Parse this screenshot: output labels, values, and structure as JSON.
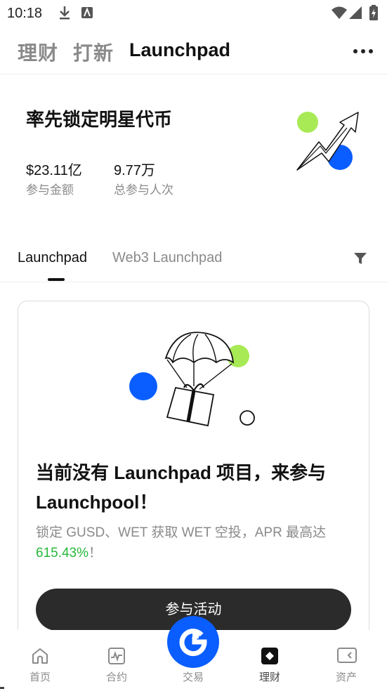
{
  "status_bar": {
    "time": "10:18",
    "icons": [
      "download-icon",
      "app-notification-icon",
      "wifi-icon",
      "signal-icon",
      "battery-icon"
    ]
  },
  "top_nav": {
    "tabs": [
      {
        "label": "理财",
        "active": false
      },
      {
        "label": "打新",
        "active": false
      },
      {
        "label": "Launchpad",
        "active": true
      }
    ],
    "more_icon": "more-dots-icon"
  },
  "hero": {
    "title": "率先锁定明星代币",
    "stats": [
      {
        "value": "$23.11亿",
        "label": "参与金额"
      },
      {
        "value": "9.77万",
        "label": "总参与人次"
      }
    ],
    "illustration": "growth-arrow-illustration"
  },
  "sub_tabs": {
    "tabs": [
      {
        "label": "Launchpad",
        "active": true
      },
      {
        "label": "Web3 Launchpad",
        "active": false
      }
    ],
    "filter_icon": "filter-icon"
  },
  "empty_card": {
    "illustration": "parachute-gift-illustration",
    "title": "当前没有 Launchpad 项目，来参与 Launchpool！",
    "desc_prefix": "锁定 GUSD、WET 获取 WET 空投，APR 最高达 ",
    "apr": "615.43%",
    "desc_suffix": "！",
    "button_label": "参与活动"
  },
  "bottom_nav": {
    "items": [
      {
        "label": "首页",
        "icon": "home-icon"
      },
      {
        "label": "合约",
        "icon": "futures-chart-icon"
      },
      {
        "label": "交易",
        "icon": "trade-logo-icon"
      },
      {
        "label": "理财",
        "icon": "earn-icon",
        "active": true
      },
      {
        "label": "资产",
        "icon": "wallet-icon"
      }
    ]
  },
  "colors": {
    "accent_blue": "#0a5eff",
    "accent_green": "#a8ea55",
    "apr_green": "#27b83a",
    "button_dark": "#2b2b2b"
  }
}
